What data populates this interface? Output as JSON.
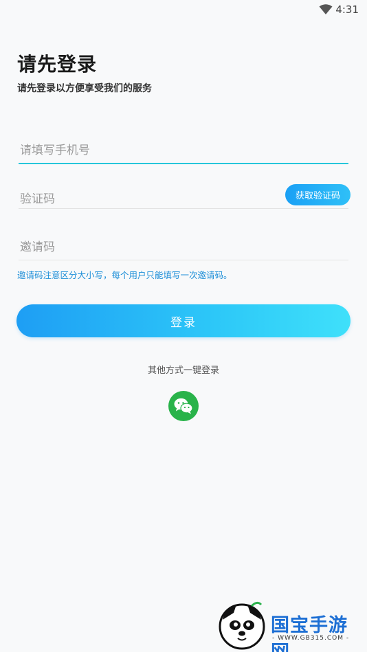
{
  "status_bar": {
    "time": "4:31"
  },
  "header": {
    "title": "请先登录",
    "subtitle": "请先登录以方便享受我们的服务"
  },
  "form": {
    "phone_placeholder": "请填写手机号",
    "code_placeholder": "验证码",
    "get_code_label": "获取验证码",
    "invite_placeholder": "邀请码",
    "invite_hint": "邀请码注意区分大小写，每个用户只能填写一次邀请码。",
    "login_label": "登录"
  },
  "social": {
    "label": "其他方式一键登录",
    "icon": "wechat-icon"
  },
  "watermark": {
    "title": "国宝手游网",
    "url": "- WWW.GB315.COM -"
  },
  "colors": {
    "accent": "#26c6da",
    "button_start": "#1e9ef4",
    "button_end": "#3fe0fa",
    "hint": "#1e8fd8",
    "wechat": "#29b34a"
  }
}
